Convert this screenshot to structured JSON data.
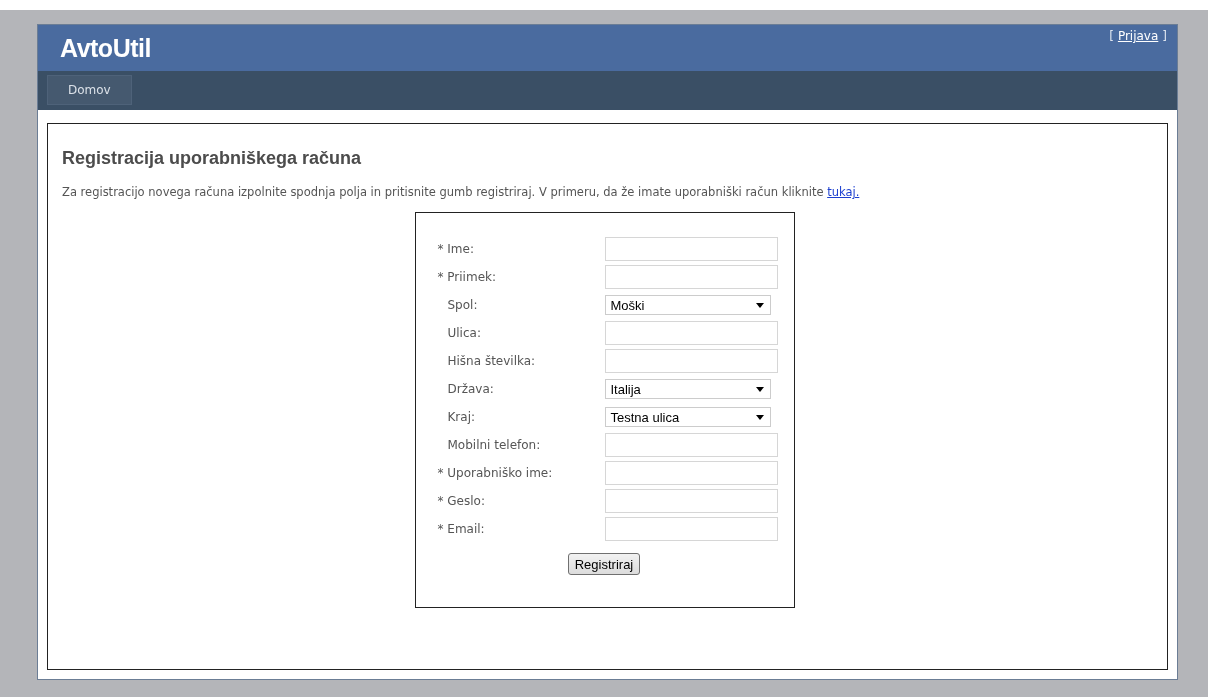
{
  "header": {
    "logo": "AvtoUtil",
    "login": {
      "open": "[",
      "link": "Prijava",
      "close": "]"
    }
  },
  "nav": [
    {
      "label": "Domov",
      "selected": true
    }
  ],
  "content": {
    "title": "Registracija uporabniškega računa",
    "intro": "Za registracijo novega računa izpolnite spodnja polja in pritisnite gumb registriraj. V primeru, da že imate uporabniški račun kliknite",
    "intro_link": "tukaj.",
    "form": {
      "fields": [
        {
          "label": "* Ime:",
          "required": true,
          "kind": "text"
        },
        {
          "label": "* Priimek:",
          "required": true,
          "kind": "text"
        },
        {
          "label": "Spol:",
          "required": false,
          "kind": "select",
          "value": "Moški"
        },
        {
          "label": "Ulica:",
          "required": false,
          "kind": "text"
        },
        {
          "label": "Hišna številka:",
          "required": false,
          "kind": "text"
        },
        {
          "label": "Država:",
          "required": false,
          "kind": "select",
          "value": "Italija"
        },
        {
          "label": "Kraj:",
          "required": false,
          "kind": "select",
          "value": "Testna ulica"
        },
        {
          "label": "Mobilni telefon:",
          "required": false,
          "kind": "text"
        },
        {
          "label": "* Uporabniško ime:",
          "required": true,
          "kind": "text"
        },
        {
          "label": "* Geslo:",
          "required": true,
          "kind": "text"
        },
        {
          "label": "* Email:",
          "required": true,
          "kind": "text"
        }
      ],
      "submit": "Registriraj"
    }
  }
}
